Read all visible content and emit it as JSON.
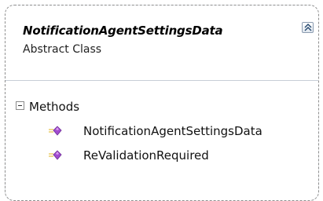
{
  "class": {
    "name": "NotificationAgentSettingsData",
    "stereotype": "Abstract Class",
    "collapse_icon": "double-chevron-up-icon"
  },
  "sections": [
    {
      "title": "Methods",
      "toggle_icon": "minus-box-icon",
      "members": [
        {
          "label": "NotificationAgentSettingsData",
          "icon": "method-icon"
        },
        {
          "label": "ReValidationRequired",
          "icon": "method-icon"
        }
      ]
    }
  ],
  "colors": {
    "method_icon": "#a04bd0",
    "method_lines": "#e5c24a"
  }
}
